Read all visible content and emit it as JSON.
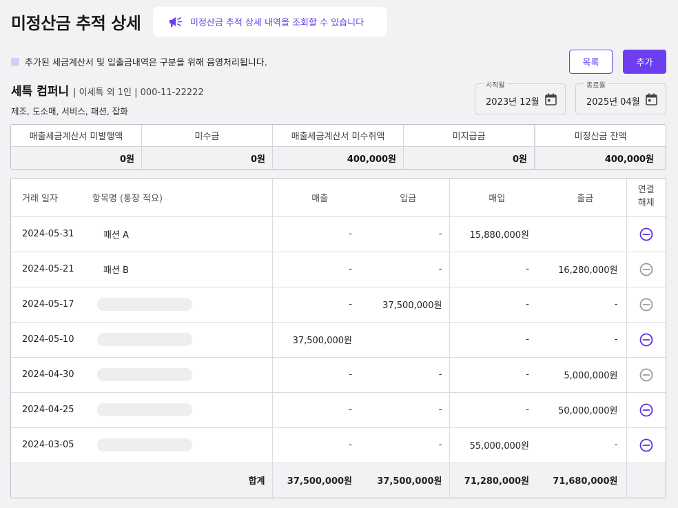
{
  "header": {
    "title": "미정산금 추적 상세",
    "notice": "미정산금 추적 상세 내역을 조회할 수 있습니다",
    "notice_icon": "megaphone-icon",
    "accent": "#6c3ef0"
  },
  "legend": {
    "text": "추가된 세금계산서 및 입출금내역은 구분을 위해 음영처리됩니다.",
    "swatch_color": "#d8ccfa"
  },
  "actions": {
    "list_label": "목록",
    "add_label": "추가"
  },
  "company": {
    "name": "세특 컴퍼니",
    "meta": "| 이세특 외 1인 | 000-11-22222",
    "industry": "제조, 도소매, 서비스, 패션, 잡화"
  },
  "period": {
    "start_label": "시작월",
    "start_value": "2023년 12월",
    "end_label": "종료월",
    "end_value": "2025년 04월"
  },
  "summary": [
    {
      "label": "매출세금계산서 미발행액",
      "value": "0원"
    },
    {
      "label": "미수금",
      "value": "0원"
    },
    {
      "label": "매출세금계산서 미수취액",
      "value": "400,000원"
    },
    {
      "label": "미지급금",
      "value": "0원"
    },
    {
      "label": "미정산금 잔액",
      "value": "400,000원"
    }
  ],
  "ledger": {
    "headers": {
      "date": "거래 일자",
      "item": "항목명 (통장 적요)",
      "sales": "매출",
      "deposit": "입금",
      "purchase": "매입",
      "withdrawal": "출금",
      "action_line1": "연결",
      "action_line2": "해제"
    },
    "rows": [
      {
        "date": "2024-05-31",
        "item": "패션 A",
        "masked": false,
        "sales": "-",
        "deposit": "-",
        "purchase": "15,880,000원",
        "withdrawal": "",
        "unlink_active": true
      },
      {
        "date": "2024-05-21",
        "item": "패션 B",
        "masked": false,
        "sales": "-",
        "deposit": "-",
        "purchase": "-",
        "withdrawal": "16,280,000원",
        "unlink_active": false
      },
      {
        "date": "2024-05-17",
        "item": "",
        "masked": true,
        "sales": "-",
        "deposit": "37,500,000원",
        "purchase": "-",
        "withdrawal": "-",
        "unlink_active": false
      },
      {
        "date": "2024-05-10",
        "item": "",
        "masked": true,
        "sales": "37,500,000원",
        "deposit": "",
        "purchase": "-",
        "withdrawal": "-",
        "unlink_active": true
      },
      {
        "date": "2024-04-30",
        "item": "",
        "masked": true,
        "sales": "-",
        "deposit": "-",
        "purchase": "-",
        "withdrawal": "5,000,000원",
        "unlink_active": false
      },
      {
        "date": "2024-04-25",
        "item": "",
        "masked": true,
        "sales": "-",
        "deposit": "-",
        "purchase": "-",
        "withdrawal": "50,000,000원",
        "unlink_active": true
      },
      {
        "date": "2024-03-05",
        "item": "",
        "masked": true,
        "sales": "-",
        "deposit": "-",
        "purchase": "55,000,000원",
        "withdrawal": "-",
        "unlink_active": true
      }
    ],
    "totals": {
      "label": "합계",
      "sales": "37,500,000원",
      "deposit": "37,500,000원",
      "purchase": "71,280,000원",
      "withdrawal": "71,680,000원"
    },
    "unlink_icon": "minus-circle-icon",
    "active_color": "#5b2fe0",
    "inactive_color": "#9a9aa0"
  }
}
